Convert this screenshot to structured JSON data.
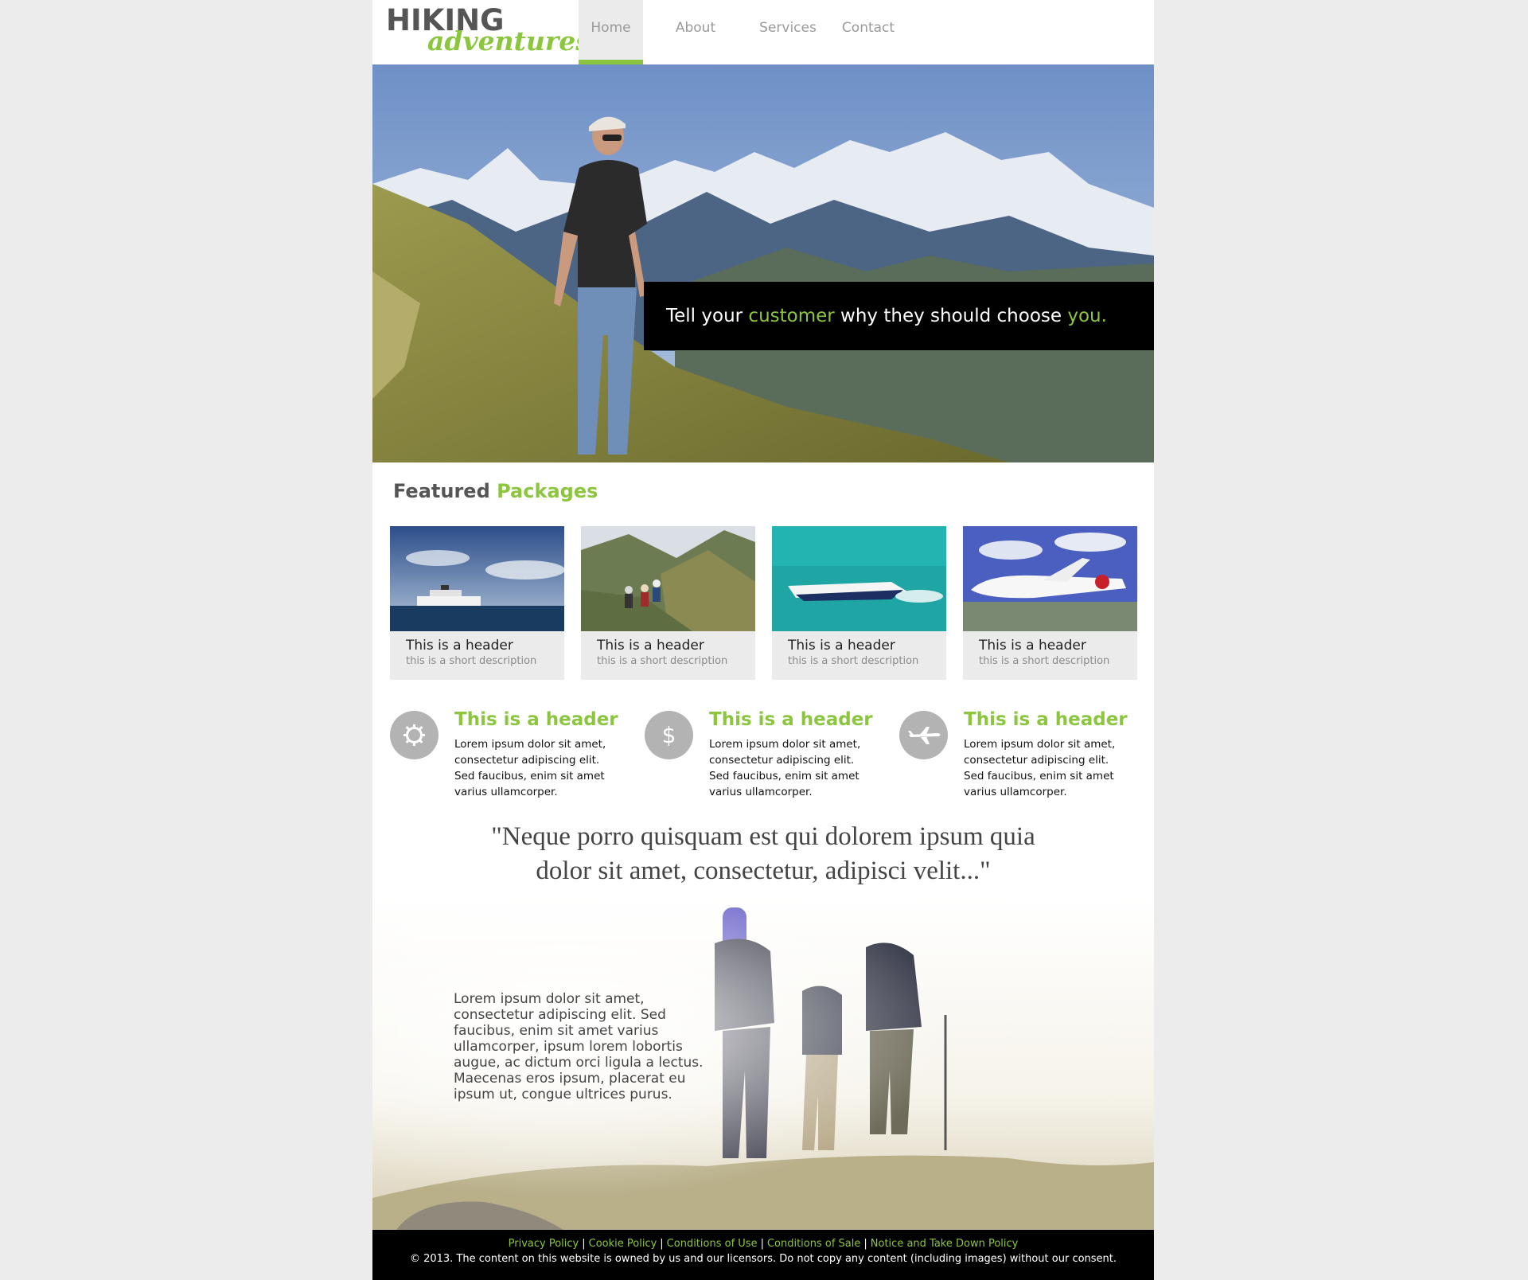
{
  "brand": {
    "line1": "HIKING",
    "line2": "adventures"
  },
  "nav": {
    "items": [
      {
        "label": "Home",
        "active": true
      },
      {
        "label": "About",
        "active": false
      },
      {
        "label": "Services",
        "active": false
      },
      {
        "label": "Contact",
        "active": false
      }
    ]
  },
  "hero": {
    "part1": "Tell your ",
    "accent1": "customer",
    "part2": " why they should choose ",
    "accent2": "you."
  },
  "featured": {
    "title_part1": "Featured ",
    "title_part2": "Packages",
    "cards": [
      {
        "image": "cruise-ship-photo",
        "title": "This is a header",
        "desc": "this is a short description"
      },
      {
        "image": "mountain-hikers-photo",
        "title": "This is a header",
        "desc": "this is a short description"
      },
      {
        "image": "speedboat-photo",
        "title": "This is a header",
        "desc": "this is a short description"
      },
      {
        "image": "private-jet-photo",
        "title": "This is a header",
        "desc": "this is a short description"
      }
    ]
  },
  "features": [
    {
      "icon": "gear-icon",
      "title": "This is a header",
      "text": "Lorem ipsum dolor sit amet, consectetur adipiscing elit. Sed faucibus, enim sit amet varius ullamcorper."
    },
    {
      "icon": "dollar-icon",
      "title": "This is a header",
      "text": "Lorem ipsum dolor sit amet, consectetur adipiscing elit. Sed faucibus, enim sit amet varius ullamcorper."
    },
    {
      "icon": "airplane-icon",
      "title": "This is a header",
      "text": "Lorem ipsum dolor sit amet, consectetur adipiscing elit. Sed faucibus, enim sit amet varius ullamcorper."
    }
  ],
  "quote": {
    "line1": "\"Neque porro quisquam est qui dolorem ipsum quia",
    "line2": "dolor sit amet, consectetur, adipisci velit...\""
  },
  "hikers_text": "Lorem ipsum dolor sit amet, consectetur adipiscing elit. Sed faucibus, enim sit amet varius ullamcorper, ipsum lorem lobortis augue, ac dictum orci ligula a lectus. Maecenas eros ipsum, placerat eu ipsum ut, congue ultrices purus.",
  "footer": {
    "links": [
      "Privacy Policy",
      "Cookie Policy",
      "Conditions of Use",
      "Conditions of Sale",
      "Notice and Take Down Policy"
    ],
    "separator": "|",
    "copyright": "© 2013. The content on this website is owned by us and our licensors. Do not copy any content (including images) without our consent."
  },
  "colors": {
    "accent": "#8cc63f",
    "text_dark": "#555555",
    "nav_text": "#9a9a9a",
    "footer_bg": "#000000",
    "page_bg": "#ececec"
  }
}
